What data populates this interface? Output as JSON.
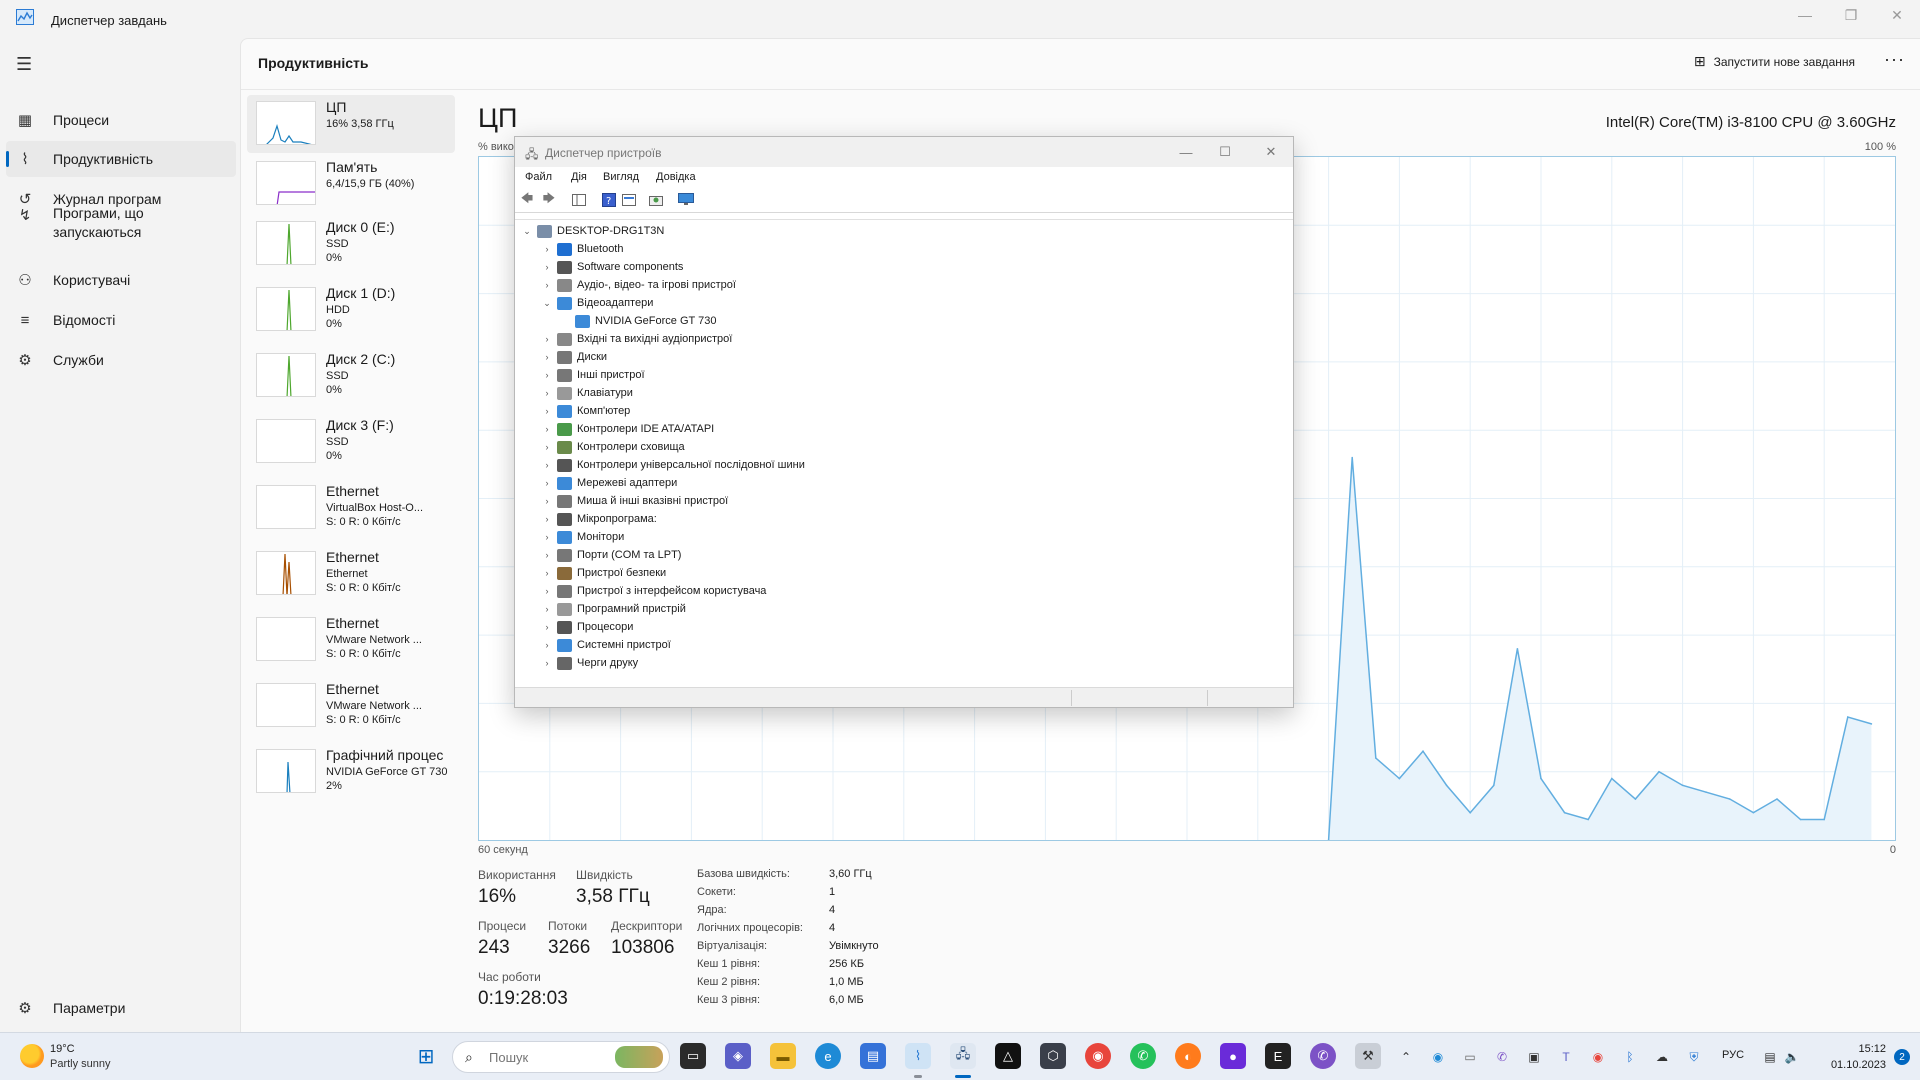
{
  "window": {
    "title": "Диспетчер завдань"
  },
  "nav": {
    "items": [
      {
        "label": "Процеси",
        "icon": "processes-icon"
      },
      {
        "label": "Продуктивність",
        "icon": "performance-icon",
        "active": true
      },
      {
        "label": "Журнал програм",
        "icon": "history-icon"
      },
      {
        "label": "Програми, що запускаються",
        "icon": "startup-icon"
      },
      {
        "label": "Користувачі",
        "icon": "users-icon"
      },
      {
        "label": "Відомості",
        "icon": "details-icon"
      },
      {
        "label": "Служби",
        "icon": "services-icon"
      }
    ],
    "settings_label": "Параметри"
  },
  "header": {
    "title": "Продуктивність",
    "new_task_label": "Запустити нове завдання",
    "more_label": "···"
  },
  "resources": [
    {
      "name": "ЦП",
      "sub1": "16% 3,58 ГГц",
      "sub2": "",
      "sub3": "",
      "active": true,
      "color": "#1a7fbe"
    },
    {
      "name": "Пам'ять",
      "sub1": "6,4/15,9 ГБ (40%)",
      "sub2": "",
      "sub3": "",
      "color": "#8b2fc9"
    },
    {
      "name": "Диск 0 (E:)",
      "sub1": "SSD",
      "sub2": "0%",
      "sub3": "",
      "color": "#4ea72e"
    },
    {
      "name": "Диск 1 (D:)",
      "sub1": "HDD",
      "sub2": "0%",
      "sub3": "",
      "color": "#4ea72e"
    },
    {
      "name": "Диск 2 (C:)",
      "sub1": "SSD",
      "sub2": "0%",
      "sub3": "",
      "color": "#4ea72e"
    },
    {
      "name": "Диск 3 (F:)",
      "sub1": "SSD",
      "sub2": "0%",
      "sub3": "",
      "color": "#4ea72e"
    },
    {
      "name": "Ethernet",
      "sub1": "VirtualBox Host-O...",
      "sub2": "S: 0 R: 0 Кбіт/с",
      "sub3": "",
      "color": "#a74f01"
    },
    {
      "name": "Ethernet",
      "sub1": "Ethernet",
      "sub2": "S: 0 R: 0 Кбіт/с",
      "sub3": "",
      "color": "#a74f01"
    },
    {
      "name": "Ethernet",
      "sub1": "VMware Network ...",
      "sub2": "S: 0 R: 0 Кбіт/с",
      "sub3": "",
      "color": "#a74f01"
    },
    {
      "name": "Ethernet",
      "sub1": "VMware Network ...",
      "sub2": "S: 0 R: 0 Кбіт/с",
      "sub3": "",
      "color": "#a74f01"
    },
    {
      "name": "Графічний процес",
      "sub1": "NVIDIA GeForce GT 730",
      "sub2": "2%",
      "sub3": "",
      "color": "#1a7fbe"
    }
  ],
  "cpu": {
    "title": "ЦП",
    "model": "Intel(R) Core(TM) i3-8100 CPU @ 3.60GHz",
    "util_label": "% використання",
    "max_label": "100 %",
    "x_label": "60 секунд",
    "min_label": "0",
    "stats": {
      "usage_label": "Використання",
      "usage_value": "16%",
      "speed_label": "Швидкість",
      "speed_value": "3,58 ГГц",
      "processes_label": "Процеси",
      "processes_value": "243",
      "threads_label": "Потоки",
      "threads_value": "3266",
      "handles_label": "Дескриптори",
      "handles_value": "103806",
      "uptime_label": "Час роботи",
      "uptime_value": "0:19:28:03"
    },
    "specs": [
      {
        "label": "Базова швидкість:",
        "value": "3,60 ГГц"
      },
      {
        "label": "Сокети:",
        "value": "1"
      },
      {
        "label": "Ядра:",
        "value": "4"
      },
      {
        "label": "Логічних процесорів:",
        "value": "4"
      },
      {
        "label": "Віртуалізація:",
        "value": "Увімкнуто"
      },
      {
        "label": "Кеш 1 рівня:",
        "value": "256 КБ"
      },
      {
        "label": "Кеш 2 рівня:",
        "value": "1,0 МБ"
      },
      {
        "label": "Кеш 3 рівня:",
        "value": "6,0 МБ"
      }
    ]
  },
  "chart_data": {
    "type": "area",
    "title": "ЦП",
    "xlabel": "60 секунд",
    "ylabel": "% використання",
    "xlim": [
      60,
      0
    ],
    "ylim": [
      0,
      100
    ],
    "grid": true,
    "x": [
      60,
      59,
      58,
      57,
      56,
      55,
      54,
      53,
      52,
      51,
      50,
      49,
      48,
      47,
      46,
      45,
      44,
      43,
      42,
      41,
      40,
      39,
      38,
      37,
      36,
      35,
      34,
      33,
      32,
      31,
      30,
      29,
      28,
      27,
      26,
      25,
      24,
      23,
      22,
      21,
      20,
      19,
      18,
      17,
      16,
      15,
      14,
      13,
      12,
      11,
      10,
      9,
      8,
      7,
      6,
      5,
      4,
      3,
      2,
      1,
      0
    ],
    "values": [
      null,
      null,
      null,
      null,
      null,
      null,
      null,
      null,
      null,
      null,
      null,
      null,
      null,
      null,
      null,
      null,
      null,
      null,
      null,
      null,
      null,
      null,
      null,
      null,
      null,
      null,
      null,
      null,
      null,
      null,
      null,
      null,
      null,
      null,
      null,
      null,
      0,
      56,
      12,
      9,
      13,
      8,
      4,
      8,
      28,
      9,
      4,
      3,
      9,
      6,
      10,
      8,
      7,
      6,
      4,
      6,
      3,
      3,
      18,
      17,
      null
    ]
  },
  "device_manager": {
    "title": "Диспетчер пристроїв",
    "menu": [
      "Файл",
      "Дія",
      "Вигляд",
      "Довідка"
    ],
    "root": "DESKTOP-DRG1T3N",
    "nodes": [
      {
        "label": "Bluetooth",
        "icon": "#1f6fd1",
        "expanded": false,
        "level": 1
      },
      {
        "label": "Software components",
        "icon": "#555555",
        "expanded": false,
        "level": 1
      },
      {
        "label": "Аудіо-, відео- та ігрові пристрої",
        "icon": "#888888",
        "expanded": false,
        "level": 1
      },
      {
        "label": "Відеоадаптери",
        "icon": "#3c8ad8",
        "expanded": true,
        "level": 1
      },
      {
        "label": "NVIDIA GeForce GT 730",
        "icon": "#3c8ad8",
        "expanded": null,
        "level": 2
      },
      {
        "label": "Вхідні та вихідні аудіопристрої",
        "icon": "#888888",
        "expanded": false,
        "level": 1
      },
      {
        "label": "Диски",
        "icon": "#777777",
        "expanded": false,
        "level": 1
      },
      {
        "label": "Інші пристрої",
        "icon": "#777777",
        "expanded": false,
        "level": 1
      },
      {
        "label": "Клавіатури",
        "icon": "#999999",
        "expanded": false,
        "level": 1
      },
      {
        "label": "Комп'ютер",
        "icon": "#3c8ad8",
        "expanded": false,
        "level": 1
      },
      {
        "label": "Контролери IDE ATA/ATAPI",
        "icon": "#4a9a4a",
        "expanded": false,
        "level": 1
      },
      {
        "label": "Контролери сховища",
        "icon": "#6a8a4a",
        "expanded": false,
        "level": 1
      },
      {
        "label": "Контролери універсальної послідовної шини",
        "icon": "#555555",
        "expanded": false,
        "level": 1
      },
      {
        "label": "Мережеві адаптери",
        "icon": "#3c8ad8",
        "expanded": false,
        "level": 1
      },
      {
        "label": "Миша й інші вказівні пристрої",
        "icon": "#777777",
        "expanded": false,
        "level": 1
      },
      {
        "label": "Мікропрограма:",
        "icon": "#555555",
        "expanded": false,
        "level": 1
      },
      {
        "label": "Монітори",
        "icon": "#3c8ad8",
        "expanded": false,
        "level": 1
      },
      {
        "label": "Порти (COM та LPT)",
        "icon": "#777777",
        "expanded": false,
        "level": 1
      },
      {
        "label": "Пристрої безпеки",
        "icon": "#8a6a3a",
        "expanded": false,
        "level": 1
      },
      {
        "label": "Пристрої з інтерфейсом користувача",
        "icon": "#777777",
        "expanded": false,
        "level": 1
      },
      {
        "label": "Програмний пристрій",
        "icon": "#999999",
        "expanded": false,
        "level": 1
      },
      {
        "label": "Процесори",
        "icon": "#555555",
        "expanded": false,
        "level": 1
      },
      {
        "label": "Системні пристрої",
        "icon": "#3c8ad8",
        "expanded": false,
        "level": 1
      },
      {
        "label": "Черги друку",
        "icon": "#666666",
        "expanded": false,
        "level": 1
      }
    ]
  },
  "taskbar": {
    "weather_temp": "19°C",
    "weather_desc": "Partly sunny",
    "search_placeholder": "Пошук",
    "language": "РУС",
    "time": "15:12",
    "date": "01.10.2023",
    "notification_count": "2"
  }
}
